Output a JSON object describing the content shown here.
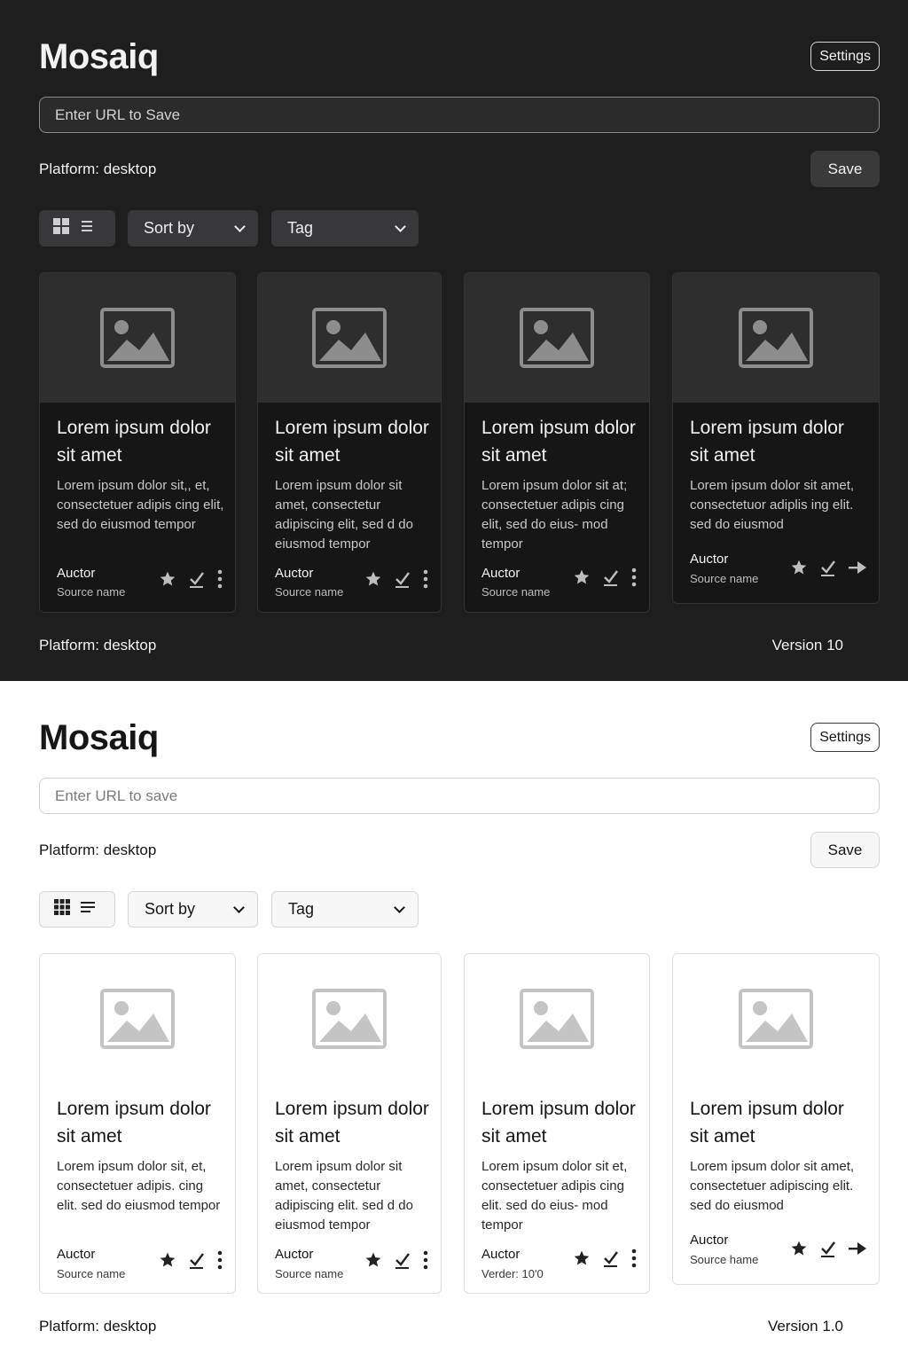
{
  "dark": {
    "app_title": "Mosaiq",
    "settings_label": "Settings",
    "url_placeholder": "Enter URL to Save",
    "platform_label": "Platform: desktop",
    "save_label": "Save",
    "sort_label": "Sort by",
    "tag_label": "Tag",
    "cards": [
      {
        "title": "Lorem ipsum dolor sit amet",
        "description": "Lorem ipsum dolor sit,, et, consectetuer adipis cing elit, sed do eiusmod tempor",
        "author": "Auctor",
        "source": "Source name"
      },
      {
        "title": "Lorem ipsum dolor sit amet",
        "description": "Lorem ipsum dolor sit amet, consectetur adipiscing elit, sed d do eiusmod tempor",
        "author": "Auctor",
        "source": "Source name"
      },
      {
        "title": "Lorem ipsum dolor sit amet",
        "description": "Lorem ipsum dolor sit at; consectetuer adipis cing elit, sed do eius- mod tempor",
        "author": "Auctor",
        "source": "Source name"
      },
      {
        "title": "Lorem ipsum dolor sit amet",
        "description": "Lorem ipsum dolor sit amet, consectetuor adiplis ing elit. sed do eiusmod",
        "author": "Auctor",
        "source": "Source name"
      }
    ],
    "footer_platform": "Platform: desktop",
    "footer_version": "Version 10"
  },
  "light": {
    "app_title": "Mosaiq",
    "settings_label": "Settings",
    "url_placeholder": "Enter URL to save",
    "platform_label": "Platform: desktop",
    "save_label": "Save",
    "sort_label": "Sort by",
    "tag_label": "Tag",
    "cards": [
      {
        "title": "Lorem ipsum dolor sit amet",
        "description": "Lorem ipsum dolor sit, et, consectetuer adipis. cing elit. sed do eiusmod tempor",
        "author": "Auctor",
        "source": "Source name"
      },
      {
        "title": "Lorem ipsum dolor sit amet",
        "description": "Lorem ipsum dolor sit amet, consectetur adipiscing elit. sed d do eiusmod tempor",
        "author": "Auctor",
        "source": "Source name"
      },
      {
        "title": "Lorem ipsum dolor sit amet",
        "description": "Lorem ipsum dolor sit et, consectetuer adipis cing elit. sed do eius- mod tempor",
        "author": "Auctor",
        "source": "Verder: 10'0"
      },
      {
        "title": "Lorem ipsum dolor sit amet",
        "description": "Lorem ipsum dolor sit amet, consectetuer adipiscing elit. sed do eiusmod",
        "author": "Auctor",
        "source": "Source hame"
      }
    ],
    "footer_platform": "Platform: desktop",
    "footer_version": "Version 1.0"
  },
  "icons": {
    "grid": "grid-view-icon",
    "list": "list-view-icon",
    "image": "image-placeholder-icon",
    "star": "star-icon",
    "check": "check-icon",
    "more": "more-vertical-icon",
    "arrow": "arrow-right-icon"
  }
}
